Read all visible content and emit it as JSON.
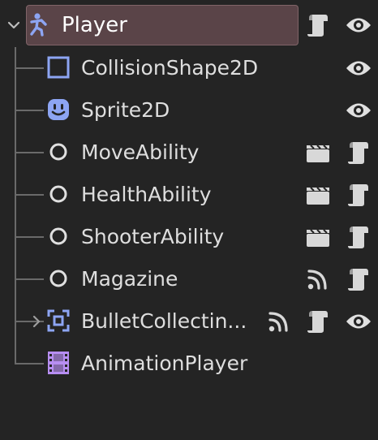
{
  "scene_tree": {
    "nodes": [
      {
        "label": "Player",
        "icon": "player-node-icon",
        "selected": true
      },
      {
        "label": "CollisionShape2D",
        "icon": "collision-shape-icon"
      },
      {
        "label": "Sprite2D",
        "icon": "sprite2d-icon"
      },
      {
        "label": "MoveAbility",
        "icon": "node-circle-icon"
      },
      {
        "label": "HealthAbility",
        "icon": "node-circle-icon"
      },
      {
        "label": "ShooterAbility",
        "icon": "node-circle-icon"
      },
      {
        "label": "Magazine",
        "icon": "node-circle-icon"
      },
      {
        "label": "BulletCollectin...",
        "icon": "area2d-icon",
        "collapsed": true
      },
      {
        "label": "AnimationPlayer",
        "icon": "animation-player-icon"
      }
    ]
  },
  "colors": {
    "background": "#242424",
    "selection": "#5a4448",
    "accent_blue": "#8da5f3",
    "accent_purple": "#b78ef2",
    "text": "#dedede"
  }
}
